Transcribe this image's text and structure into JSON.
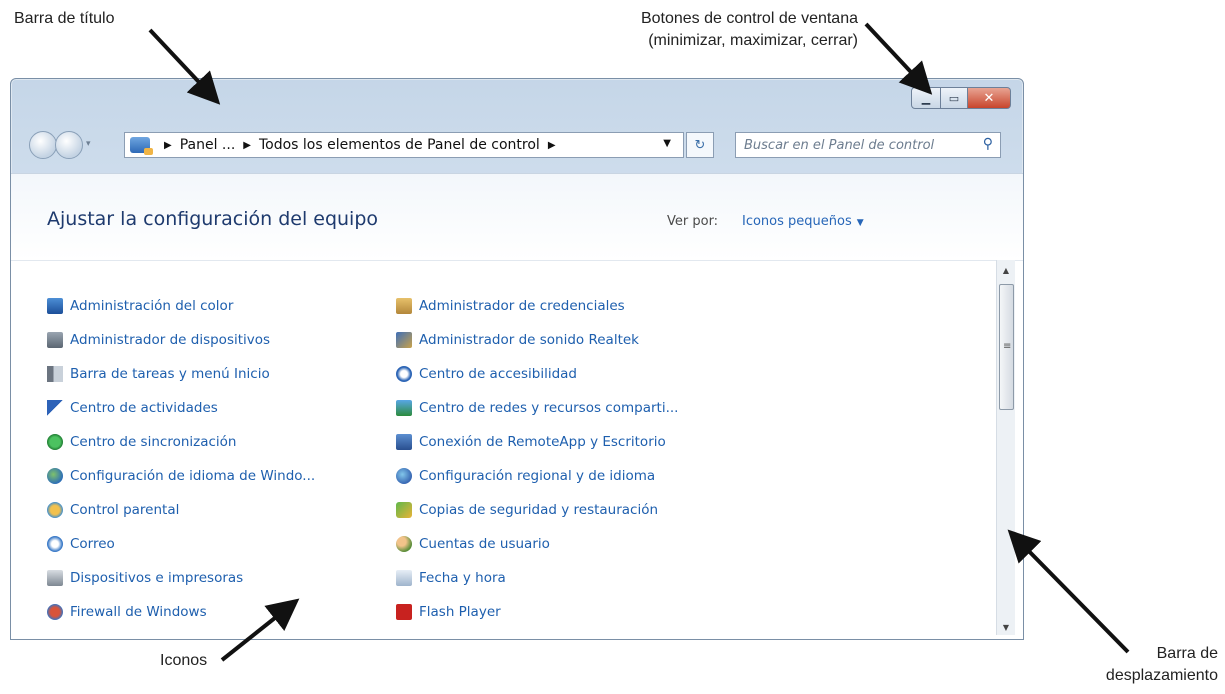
{
  "callouts": {
    "title_bar": "Barra de título",
    "window_controls_line1": "Botones de control de ventana",
    "window_controls_line2": "(minimizar, maximizar, cerrar)",
    "icons": "Iconos",
    "scrollbar_line1": "Barra de",
    "scrollbar_line2": "desplazamiento"
  },
  "navigation": {
    "breadcrumb": [
      "Panel ...",
      "Todos los elementos de Panel de control"
    ],
    "search_placeholder": "Buscar en el Panel de control"
  },
  "header": {
    "title": "Ajustar la configuración del equipo",
    "view_by_label": "Ver por:",
    "view_by_value": "Iconos pequeños"
  },
  "items": {
    "left": [
      {
        "label": "Administración del color",
        "icon": "color-management-icon"
      },
      {
        "label": "Administrador de dispositivos",
        "icon": "device-manager-icon"
      },
      {
        "label": "Barra de tareas y menú Inicio",
        "icon": "taskbar-icon"
      },
      {
        "label": "Centro de actividades",
        "icon": "action-center-flag-icon"
      },
      {
        "label": "Centro de sincronización",
        "icon": "sync-center-icon"
      },
      {
        "label": "Configuración de idioma de Windo...",
        "icon": "language-globe-icon"
      },
      {
        "label": "Control parental",
        "icon": "parental-control-icon"
      },
      {
        "label": "Correo",
        "icon": "mail-icon"
      },
      {
        "label": "Dispositivos e impresoras",
        "icon": "printer-icon"
      },
      {
        "label": "Firewall de Windows",
        "icon": "firewall-icon"
      }
    ],
    "right": [
      {
        "label": "Administrador de credenciales",
        "icon": "credential-vault-icon"
      },
      {
        "label": "Administrador de sonido Realtek",
        "icon": "realtek-sound-icon"
      },
      {
        "label": "Centro de accesibilidad",
        "icon": "accessibility-icon"
      },
      {
        "label": "Centro de redes y recursos comparti...",
        "icon": "network-icon"
      },
      {
        "label": "Conexión de RemoteApp y Escritorio",
        "icon": "remoteapp-icon"
      },
      {
        "label": "Configuración regional y de idioma",
        "icon": "regional-globe-icon"
      },
      {
        "label": "Copias de seguridad y restauración",
        "icon": "backup-icon"
      },
      {
        "label": "Cuentas de usuario",
        "icon": "user-accounts-icon"
      },
      {
        "label": "Fecha y hora",
        "icon": "date-time-icon"
      },
      {
        "label": "Flash Player",
        "icon": "flash-player-icon"
      }
    ]
  },
  "colors": {
    "link": "#1e5fae",
    "title": "#1e3a6e",
    "close_button": "#c8452c",
    "window_frame": "#c5d6e8"
  }
}
